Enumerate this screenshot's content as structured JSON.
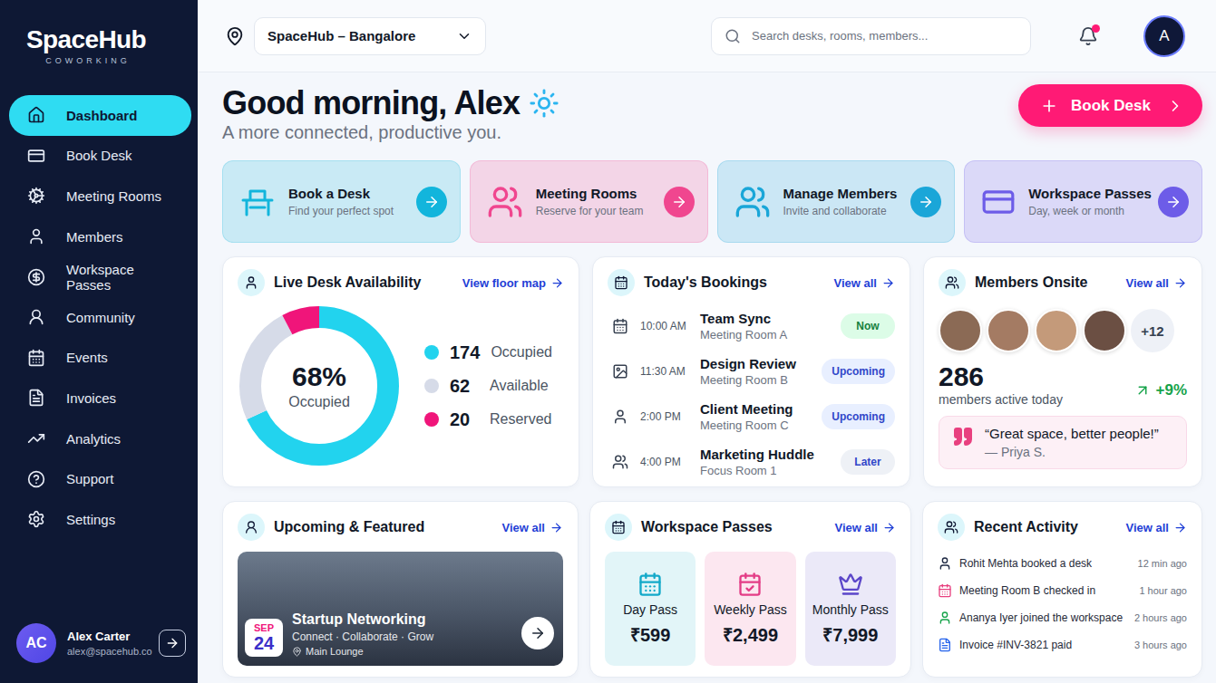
{
  "brand": {
    "name": "SpaceHub",
    "tagline": "COWORKING"
  },
  "sidebar": {
    "items": [
      {
        "label": "Dashboard",
        "selected": true
      },
      {
        "label": "Book Desk",
        "selected": false
      },
      {
        "label": "Meeting Rooms",
        "selected": false
      },
      {
        "label": "Members",
        "selected": false
      },
      {
        "label": "Workspace Passes",
        "selected": false
      },
      {
        "label": "Community",
        "selected": false
      },
      {
        "label": "Events",
        "selected": false
      },
      {
        "label": "Invoices",
        "selected": false
      },
      {
        "label": "Analytics",
        "selected": false
      },
      {
        "label": "Support",
        "selected": false
      },
      {
        "label": "Settings",
        "selected": false
      }
    ]
  },
  "user": {
    "initials": "AC",
    "name": "Alex Carter",
    "email": "alex@spacehub.co"
  },
  "topbar": {
    "location": "SpaceHub – Bangalore",
    "search_placeholder": "Search desks, rooms, members...",
    "notifications_unread": true,
    "avatar": "A"
  },
  "greeting": {
    "title": "Good morning, Alex",
    "subtitle": "A more connected, productive you.",
    "button": "Book Desk"
  },
  "quick_actions": [
    {
      "title": "Book a Desk",
      "subtitle": "Find your perfect spot",
      "color": "#12b5dc"
    },
    {
      "title": "Meeting Rooms",
      "subtitle": "Reserve for your team",
      "color": "#f0468f"
    },
    {
      "title": "Manage Members",
      "subtitle": "Invite and collaborate",
      "color": "#1aa6d8"
    },
    {
      "title": "Workspace Passes",
      "subtitle": "Day, week or month",
      "color": "#6d5ce8"
    }
  ],
  "desk_availability": {
    "title": "Live Desk Availability",
    "link": "View floor map",
    "center_value": "68%",
    "center_label": "Occupied",
    "segments": [
      {
        "label": "Occupied",
        "value": "174",
        "count": 174,
        "color": "#22d3ee"
      },
      {
        "label": "Available",
        "value": "62",
        "count": 62,
        "color": "#d6dbe8"
      },
      {
        "label": "Reserved",
        "value": "20",
        "count": 20,
        "color": "#f0157a"
      }
    ]
  },
  "bookings": {
    "title": "Today's Bookings",
    "link": "View all",
    "items": [
      {
        "time": "10:00 AM",
        "title": "Team Sync",
        "room": "Meeting Room A",
        "status": "Now",
        "kind": "now"
      },
      {
        "time": "11:30 AM",
        "title": "Design Review",
        "room": "Meeting Room B",
        "status": "Upcoming",
        "kind": "upcoming"
      },
      {
        "time": "2:00 PM",
        "title": "Client Meeting",
        "room": "Meeting Room C",
        "status": "Upcoming",
        "kind": "upcoming"
      },
      {
        "time": "4:00 PM",
        "title": "Marketing Huddle",
        "room": "Focus Room 1",
        "status": "Later",
        "kind": "later"
      }
    ]
  },
  "members_onsite": {
    "title": "Members Onsite",
    "link": "View all",
    "avatars": [
      {
        "color": "#8b6a55"
      },
      {
        "color": "#a47b63"
      },
      {
        "color": "#c49a7a"
      },
      {
        "color": "#6b4f43"
      }
    ],
    "more": "+12",
    "count": "286",
    "count_label": "members active today",
    "trend": "+9%",
    "quote": "“Great space, better people!”",
    "quote_author": "— Priya S."
  },
  "featured": {
    "title": "Upcoming & Featured",
    "link": "View all",
    "event": {
      "month": "SEP",
      "day": "24",
      "title": "Startup Networking",
      "subtitle": "Connect · Collaborate · Grow",
      "location": "Main Lounge"
    }
  },
  "passes": {
    "title": "Workspace Passes",
    "link": "View all",
    "items": [
      {
        "name": "Day Pass",
        "price": "₹599",
        "color": "#13a9c9"
      },
      {
        "name": "Weekly Pass",
        "price": "₹2,499",
        "color": "#e33d86"
      },
      {
        "name": "Monthly Pass",
        "price": "₹7,999",
        "color": "#5b46c9"
      }
    ]
  },
  "activity": {
    "title": "Recent Activity",
    "link": "View all",
    "items": [
      {
        "text": "Rohit Mehta booked a desk",
        "time": "12 min ago",
        "color": "#1f2a44"
      },
      {
        "text": "Meeting Room B checked in",
        "time": "1 hour ago",
        "color": "#e8407f"
      },
      {
        "text": "Ananya Iyer joined the workspace",
        "time": "2 hours ago",
        "color": "#16a34a"
      },
      {
        "text": "Invoice #INV-3821 paid",
        "time": "3 hours ago",
        "color": "#2563eb"
      }
    ]
  }
}
